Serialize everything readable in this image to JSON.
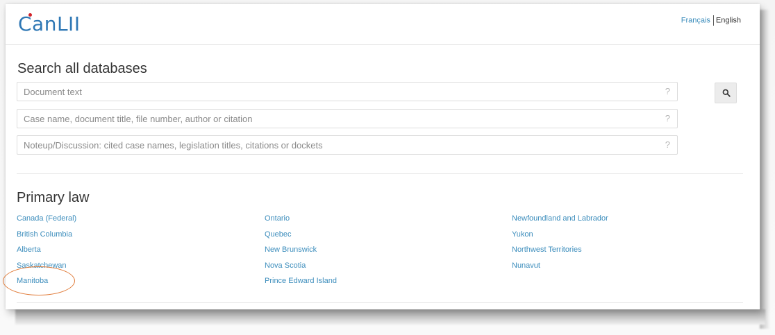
{
  "header": {
    "logo": "CanLII",
    "lang_french": "Français",
    "lang_english": "English"
  },
  "search": {
    "title": "Search all databases",
    "fields": [
      {
        "placeholder": "Document text",
        "help": "?"
      },
      {
        "placeholder": "Case name, document title, file number, author or citation",
        "help": "?"
      },
      {
        "placeholder": "Noteup/Discussion: cited case names, legislation titles, citations or dockets",
        "help": "?"
      }
    ],
    "button_icon": "search-icon"
  },
  "primary_law": {
    "title": "Primary law",
    "columns": [
      [
        "Canada (Federal)",
        "British Columbia",
        "Alberta",
        "Saskatchewan",
        "Manitoba"
      ],
      [
        "Ontario",
        "Quebec",
        "New Brunswick",
        "Nova Scotia",
        "Prince Edward Island"
      ],
      [
        "Newfoundland and Labrador",
        "Yukon",
        "Northwest Territories",
        "Nunavut"
      ]
    ],
    "highlighted": "Manitoba",
    "highlight_color": "#e07b39"
  },
  "colors": {
    "brand": "#2f78b5",
    "link": "#3c8dbc"
  }
}
